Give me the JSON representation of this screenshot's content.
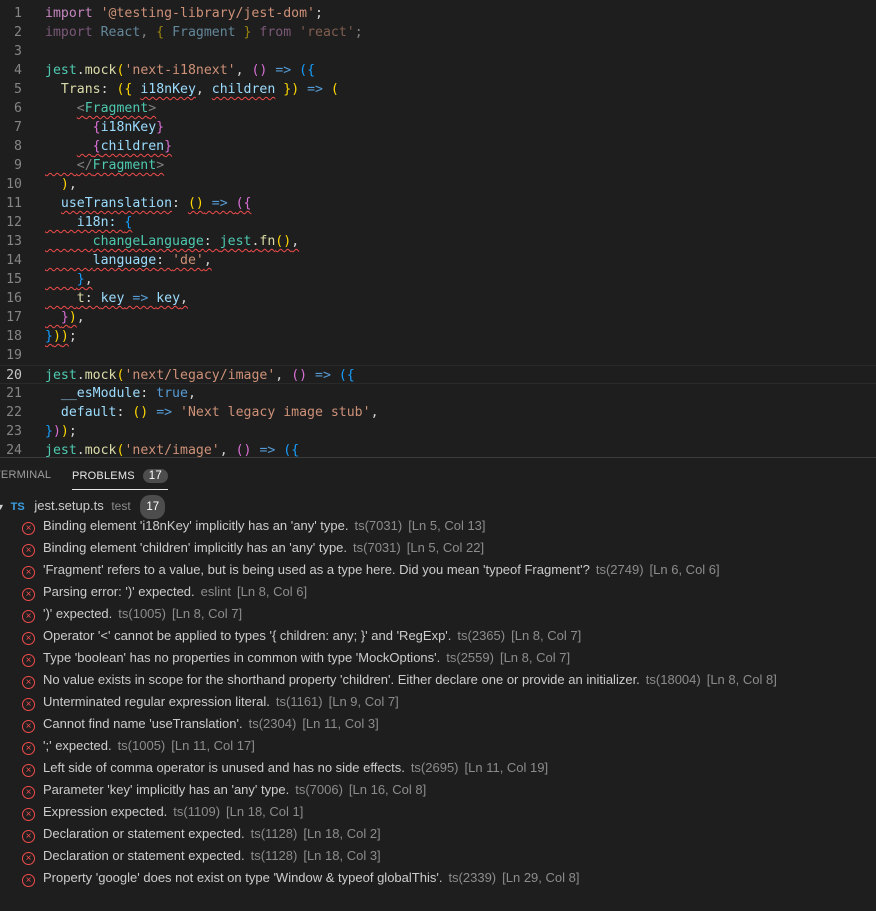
{
  "editor": {
    "current_line": 20,
    "lines": [
      {
        "n": "1",
        "t": [
          [
            "import ",
            "kw"
          ],
          [
            "'@testing-library/jest-dom'",
            "str"
          ],
          [
            ";",
            "pl"
          ]
        ]
      },
      {
        "n": "2",
        "dim": true,
        "t": [
          [
            "import ",
            "kw"
          ],
          [
            "React",
            "pr"
          ],
          [
            ", ",
            "pl"
          ],
          [
            "{ ",
            "b1"
          ],
          [
            "Fragment ",
            "pr"
          ],
          [
            "} ",
            "b1"
          ],
          [
            "from ",
            "kw"
          ],
          [
            "'react'",
            "str"
          ],
          [
            ";",
            "pl"
          ]
        ]
      },
      {
        "n": "3",
        "t": []
      },
      {
        "n": "4",
        "t": [
          [
            "jest",
            "ty"
          ],
          [
            ".",
            "pl"
          ],
          [
            "mock",
            "fn"
          ],
          [
            "(",
            "b1"
          ],
          [
            "'next-i18next'",
            "str"
          ],
          [
            ", ",
            "pl"
          ],
          [
            "()",
            "b2"
          ],
          [
            " => ",
            "cn"
          ],
          [
            "({",
            "b3"
          ]
        ]
      },
      {
        "n": "5",
        "t": [
          [
            "  Trans",
            "fn"
          ],
          [
            ": ",
            "pl"
          ],
          [
            "({",
            "b1"
          ],
          [
            " ",
            "pl"
          ],
          [
            "i18nKey",
            "pr err"
          ],
          [
            ", ",
            "pl"
          ],
          [
            "children",
            "pr err"
          ],
          [
            " ",
            "pl"
          ],
          [
            "})",
            "b1"
          ],
          [
            " => ",
            "cn"
          ],
          [
            "(",
            "b1"
          ]
        ]
      },
      {
        "n": "6",
        "t": [
          [
            "    ",
            "pl"
          ],
          [
            "<",
            "tg err"
          ],
          [
            "Fragment",
            "tag err"
          ],
          [
            ">",
            "tg err"
          ]
        ]
      },
      {
        "n": "7",
        "t": [
          [
            "      ",
            "pl"
          ],
          [
            "{",
            "b2"
          ],
          [
            "i18nKey",
            "pr"
          ],
          [
            "}",
            "b2"
          ]
        ]
      },
      {
        "n": "8",
        "t": [
          [
            "    ",
            "pl"
          ],
          [
            "  ",
            "pl err"
          ],
          [
            "{",
            "b2 err"
          ],
          [
            "children",
            "pr err"
          ],
          [
            "}",
            "b2 err"
          ]
        ]
      },
      {
        "n": "9",
        "t": [
          [
            "    ",
            "pl err"
          ],
          [
            "</",
            "tg err"
          ],
          [
            "Fragment",
            "tag err"
          ],
          [
            ">",
            "tg err"
          ]
        ]
      },
      {
        "n": "10",
        "t": [
          [
            "  ",
            "pl"
          ],
          [
            ")",
            "b1"
          ],
          [
            ",",
            "pl"
          ]
        ]
      },
      {
        "n": "11",
        "t": [
          [
            "  ",
            "pl"
          ],
          [
            "useTranslation",
            "pr err"
          ],
          [
            ": ",
            "pl"
          ],
          [
            "()",
            "b1 err"
          ],
          [
            " => ",
            "cn err"
          ],
          [
            "({",
            "b2 err"
          ]
        ]
      },
      {
        "n": "12",
        "t": [
          [
            "    i18n: ",
            "pr err"
          ],
          [
            "{",
            "b3 err"
          ]
        ]
      },
      {
        "n": "13",
        "t": [
          [
            "      ",
            "pl err"
          ],
          [
            "changeLanguage",
            "ty err"
          ],
          [
            ": ",
            "pl err"
          ],
          [
            "jest",
            "ty err"
          ],
          [
            ".",
            "pl err"
          ],
          [
            "fn",
            "fn err"
          ],
          [
            "()",
            "b1 err"
          ],
          [
            ",",
            "pl err"
          ]
        ]
      },
      {
        "n": "14",
        "t": [
          [
            "      ",
            "pl err"
          ],
          [
            "language",
            "pr err"
          ],
          [
            ": ",
            "pl err"
          ],
          [
            "'de'",
            "str err"
          ],
          [
            ",",
            "pl err"
          ]
        ]
      },
      {
        "n": "15",
        "t": [
          [
            "    ",
            "pl err"
          ],
          [
            "}",
            "b3 err"
          ],
          [
            ",",
            "pl err"
          ]
        ]
      },
      {
        "n": "16",
        "t": [
          [
            "    ",
            "pl err"
          ],
          [
            "t",
            "fn err"
          ],
          [
            ": ",
            "pl err"
          ],
          [
            "key",
            "pr err"
          ],
          [
            " => ",
            "cn err"
          ],
          [
            "key",
            "pr err"
          ],
          [
            ",",
            "pl err"
          ]
        ]
      },
      {
        "n": "17",
        "t": [
          [
            "  ",
            "pl err"
          ],
          [
            "}",
            "b2 err"
          ],
          [
            ")",
            "b1 err"
          ],
          [
            ",",
            "pl"
          ]
        ]
      },
      {
        "n": "18",
        "t": [
          [
            "}",
            "b3 err"
          ],
          [
            ")",
            "b1 err"
          ],
          [
            ")",
            "b1 err"
          ],
          [
            ";",
            "pl"
          ]
        ]
      },
      {
        "n": "19",
        "t": []
      },
      {
        "n": "20",
        "t": [
          [
            "jest",
            "ty"
          ],
          [
            ".",
            "pl"
          ],
          [
            "mock",
            "fn"
          ],
          [
            "(",
            "b1"
          ],
          [
            "'next/legacy/image'",
            "str"
          ],
          [
            ", ",
            "pl"
          ],
          [
            "()",
            "b2"
          ],
          [
            " => ",
            "cn"
          ],
          [
            "({",
            "b3"
          ]
        ]
      },
      {
        "n": "21",
        "t": [
          [
            "  __esModule",
            "pr"
          ],
          [
            ": ",
            "pl"
          ],
          [
            "true",
            "cn"
          ],
          [
            ",",
            "pl"
          ]
        ]
      },
      {
        "n": "22",
        "t": [
          [
            "  default",
            "pr"
          ],
          [
            ": ",
            "pl"
          ],
          [
            "()",
            "b1"
          ],
          [
            " => ",
            "cn"
          ],
          [
            "'Next legacy image stub'",
            "str"
          ],
          [
            ",",
            "pl"
          ]
        ]
      },
      {
        "n": "23",
        "t": [
          [
            "}",
            "b3"
          ],
          [
            ")",
            "b2"
          ],
          [
            ")",
            "b1"
          ],
          [
            ";",
            "pl"
          ]
        ]
      },
      {
        "n": "24",
        "t": [
          [
            "jest",
            "ty"
          ],
          [
            ".",
            "pl"
          ],
          [
            "mock",
            "fn"
          ],
          [
            "(",
            "b1"
          ],
          [
            "'next/image'",
            "str"
          ],
          [
            ", ",
            "pl"
          ],
          [
            "()",
            "b2"
          ],
          [
            " => ",
            "cn"
          ],
          [
            "({",
            "b3"
          ]
        ]
      }
    ]
  },
  "panel": {
    "tabs": [
      {
        "label": "TERMINAL"
      },
      {
        "label": "PROBLEMS",
        "count": "17"
      }
    ],
    "file": {
      "icon": "TS",
      "name": "jest.setup.ts",
      "folder": "test",
      "count": "17"
    },
    "problems": [
      {
        "msg": "Binding element 'i18nKey' implicitly has an 'any' type.",
        "src": "ts(7031)",
        "pos": "[Ln 5, Col 13]"
      },
      {
        "msg": "Binding element 'children' implicitly has an 'any' type.",
        "src": "ts(7031)",
        "pos": "[Ln 5, Col 22]"
      },
      {
        "msg": "'Fragment' refers to a value, but is being used as a type here. Did you mean 'typeof Fragment'?",
        "src": "ts(2749)",
        "pos": "[Ln 6, Col 6]"
      },
      {
        "msg": "Parsing error: ')' expected.",
        "src": "eslint",
        "pos": "[Ln 8, Col 6]"
      },
      {
        "msg": "')' expected.",
        "src": "ts(1005)",
        "pos": "[Ln 8, Col 7]"
      },
      {
        "msg": "Operator '<' cannot be applied to types '{ children: any; }' and 'RegExp'.",
        "src": "ts(2365)",
        "pos": "[Ln 8, Col 7]"
      },
      {
        "msg": "Type 'boolean' has no properties in common with type 'MockOptions'.",
        "src": "ts(2559)",
        "pos": "[Ln 8, Col 7]"
      },
      {
        "msg": "No value exists in scope for the shorthand property 'children'. Either declare one or provide an initializer.",
        "src": "ts(18004)",
        "pos": "[Ln 8, Col 8]"
      },
      {
        "msg": "Unterminated regular expression literal.",
        "src": "ts(1161)",
        "pos": "[Ln 9, Col 7]"
      },
      {
        "msg": "Cannot find name 'useTranslation'.",
        "src": "ts(2304)",
        "pos": "[Ln 11, Col 3]"
      },
      {
        "msg": "';' expected.",
        "src": "ts(1005)",
        "pos": "[Ln 11, Col 17]"
      },
      {
        "msg": "Left side of comma operator is unused and has no side effects.",
        "src": "ts(2695)",
        "pos": "[Ln 11, Col 19]"
      },
      {
        "msg": "Parameter 'key' implicitly has an 'any' type.",
        "src": "ts(7006)",
        "pos": "[Ln 16, Col 8]"
      },
      {
        "msg": "Expression expected.",
        "src": "ts(1109)",
        "pos": "[Ln 18, Col 1]"
      },
      {
        "msg": "Declaration or statement expected.",
        "src": "ts(1128)",
        "pos": "[Ln 18, Col 2]"
      },
      {
        "msg": "Declaration or statement expected.",
        "src": "ts(1128)",
        "pos": "[Ln 18, Col 3]"
      },
      {
        "msg": "Property 'google' does not exist on type 'Window & typeof globalThis'.",
        "src": "ts(2339)",
        "pos": "[Ln 29, Col 8]"
      }
    ]
  }
}
